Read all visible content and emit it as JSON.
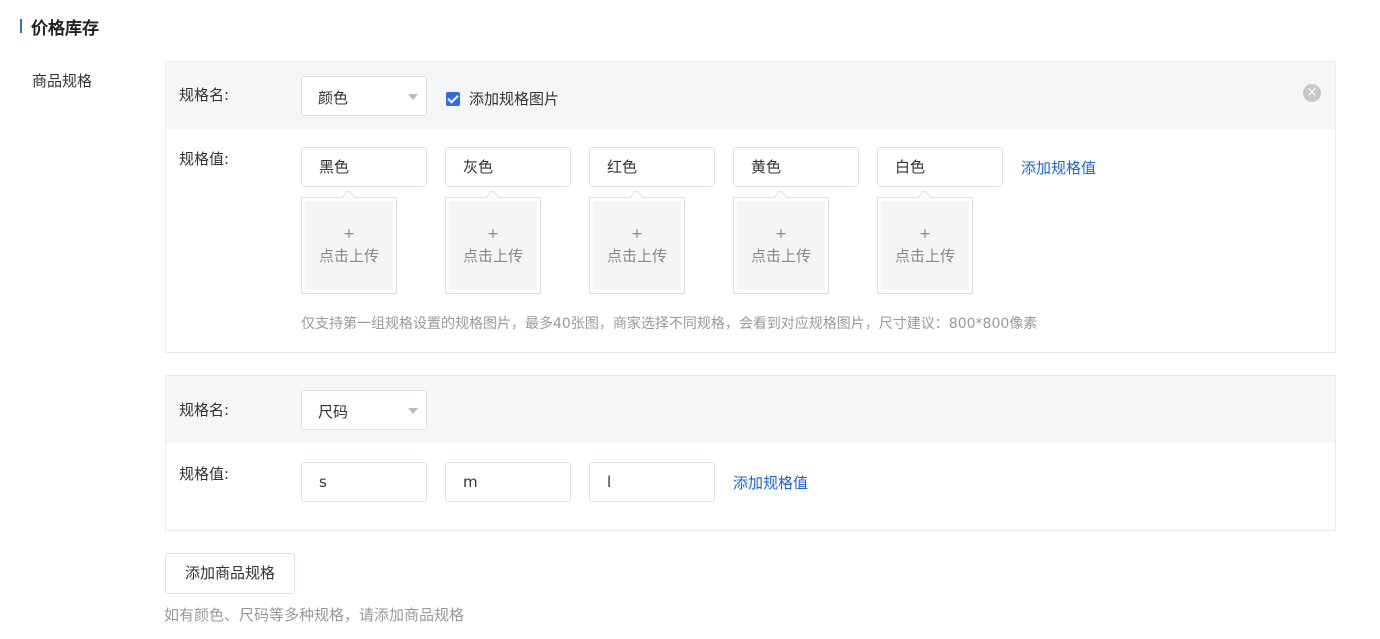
{
  "section": {
    "title": "价格库存"
  },
  "row_label": "商品规格",
  "specs": [
    {
      "name_label": "规格名:",
      "name_value": "颜色",
      "add_image_label": "添加规格图片",
      "close_icon": "×",
      "values_label": "规格值:",
      "values": [
        "黑色",
        "灰色",
        "红色",
        "黄色",
        "白色"
      ],
      "add_value_label": "添加规格值",
      "upload_plus": "+",
      "upload_label": "点击上传",
      "hint": "仅支持第一组规格设置的规格图片，最多40张图，商家选择不同规格，会看到对应规格图片，尺寸建议：800*800像素"
    },
    {
      "name_label": "规格名:",
      "name_value": "尺码",
      "values_label": "规格值:",
      "values": [
        "s",
        "m",
        "l"
      ],
      "add_value_label": "添加规格值"
    }
  ],
  "add_spec_button": "添加商品规格",
  "bottom_hint": "如有颜色、尺码等多种规格，请添加商品规格",
  "colors": {
    "accent": "#2b6de8",
    "link": "#1e63d6"
  }
}
